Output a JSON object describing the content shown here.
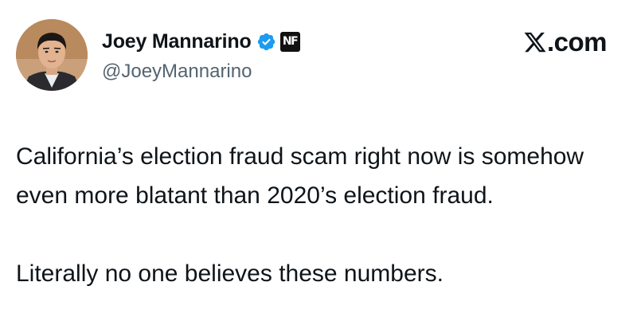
{
  "author": {
    "display_name": "Joey Mannarino",
    "handle": "@JoeyMannarino",
    "badge_text": "NF"
  },
  "platform": {
    "domain": ".com",
    "logo_icon": "x-logo-icon"
  },
  "tweet": {
    "paragraphs": [
      "California’s election fraud scam right now is somehow even more blatant than 2020’s election fraud.",
      "Literally no one believes these numbers."
    ]
  },
  "colors": {
    "text_primary": "#0f1419",
    "text_secondary": "#536471",
    "verified_blue": "#1d9bf0",
    "background": "#ffffff"
  }
}
